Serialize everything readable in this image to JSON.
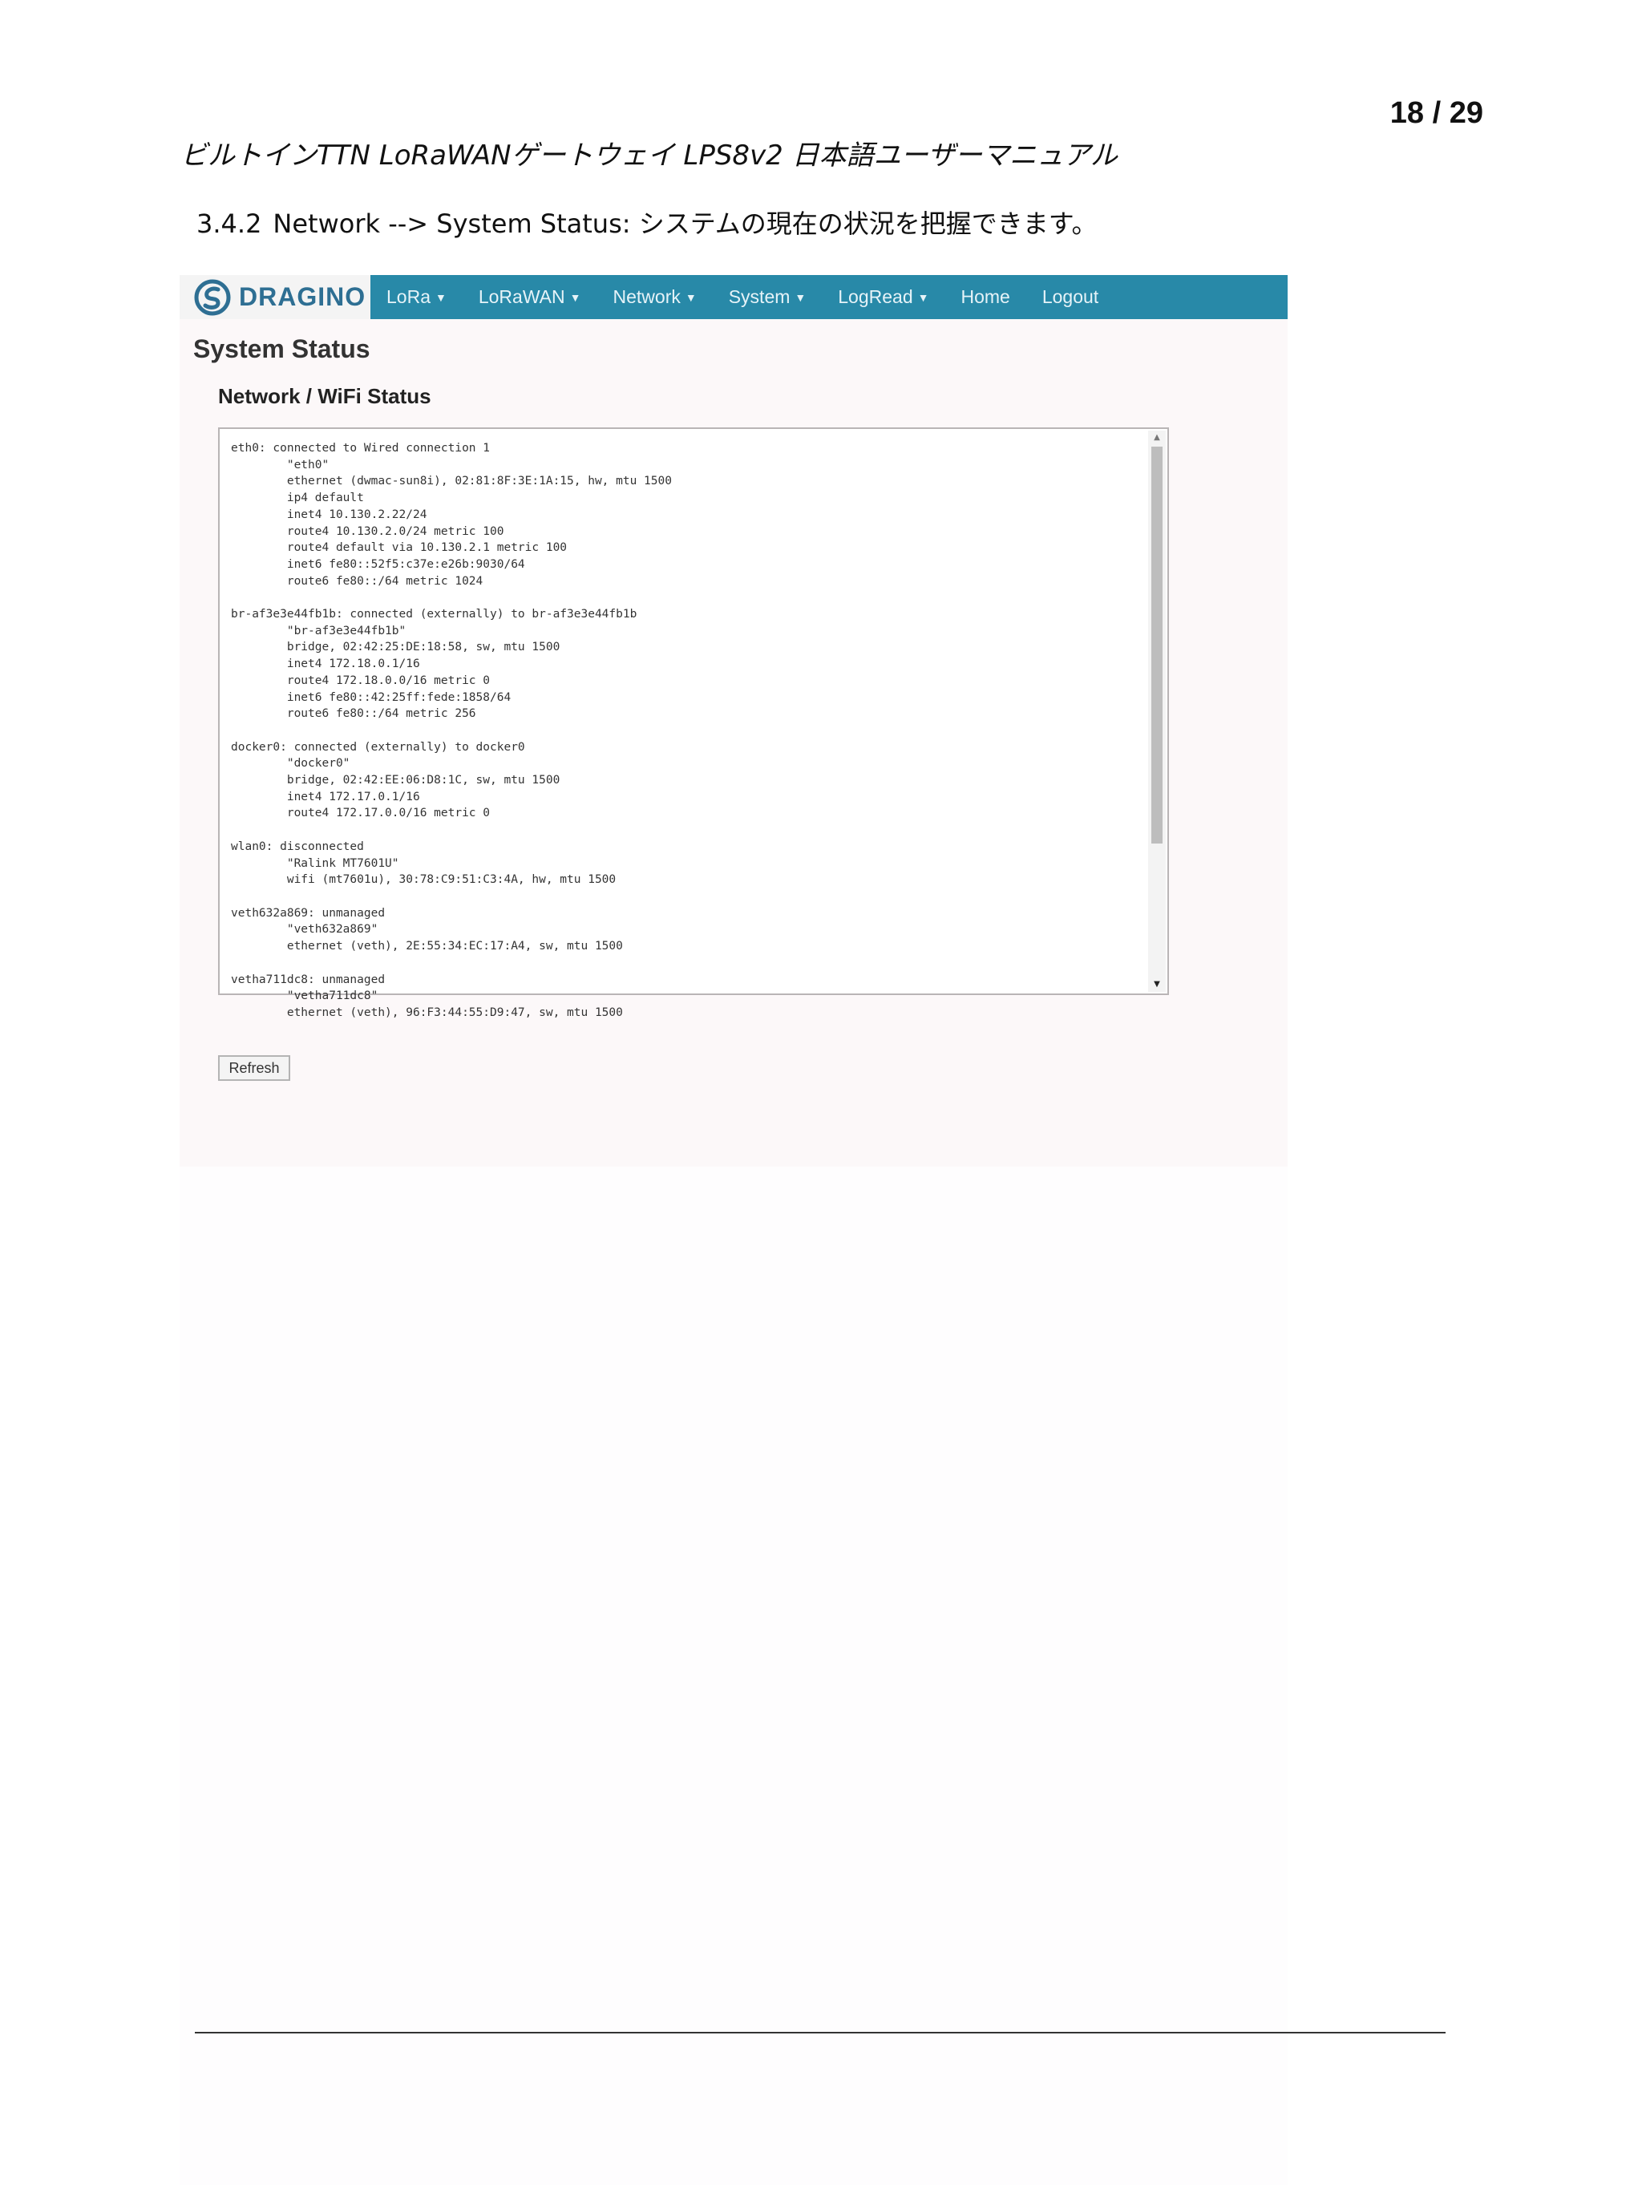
{
  "page": {
    "number": "18 / 29"
  },
  "document": {
    "title": "ビルトインTTN LoRaWANゲートウェイ LPS8v2 日本語ユーザーマニュアル",
    "section_number": "3.4.2",
    "section_heading": "Network --> System Status:  システムの現在の状況を把握できます。"
  },
  "screenshot": {
    "nav": {
      "brand": "DRAGINO",
      "items": [
        {
          "label": "LoRa",
          "caret": "▼"
        },
        {
          "label": "LoRaWAN",
          "caret": "▼"
        },
        {
          "label": "Network",
          "caret": "▼"
        },
        {
          "label": "System",
          "caret": "▼"
        },
        {
          "label": "LogRead",
          "caret": "▼"
        },
        {
          "label": "Home",
          "caret": ""
        },
        {
          "label": "Logout",
          "caret": ""
        }
      ]
    },
    "page_title": "System Status",
    "section_title": "Network / WiFi Status",
    "status_text": "eth0: connected to Wired connection 1\n        \"eth0\"\n        ethernet (dwmac-sun8i), 02:81:8F:3E:1A:15, hw, mtu 1500\n        ip4 default\n        inet4 10.130.2.22/24\n        route4 10.130.2.0/24 metric 100\n        route4 default via 10.130.2.1 metric 100\n        inet6 fe80::52f5:c37e:e26b:9030/64\n        route6 fe80::/64 metric 1024\n\nbr-af3e3e44fb1b: connected (externally) to br-af3e3e44fb1b\n        \"br-af3e3e44fb1b\"\n        bridge, 02:42:25:DE:18:58, sw, mtu 1500\n        inet4 172.18.0.1/16\n        route4 172.18.0.0/16 metric 0\n        inet6 fe80::42:25ff:fede:1858/64\n        route6 fe80::/64 metric 256\n\ndocker0: connected (externally) to docker0\n        \"docker0\"\n        bridge, 02:42:EE:06:D8:1C, sw, mtu 1500\n        inet4 172.17.0.1/16\n        route4 172.17.0.0/16 metric 0\n\nwlan0: disconnected\n        \"Ralink MT7601U\"\n        wifi (mt7601u), 30:78:C9:51:C3:4A, hw, mtu 1500\n\nveth632a869: unmanaged\n        \"veth632a869\"\n        ethernet (veth), 2E:55:34:EC:17:A4, sw, mtu 1500\n\nvetha711dc8: unmanaged\n        \"vetha711dc8\"\n        ethernet (veth), 96:F3:44:55:D9:47, sw, mtu 1500",
    "refresh_label": "Refresh",
    "colors": {
      "nav_bar": "#2889a8",
      "brand_text": "#2e6f93",
      "background": "#fcf8f9"
    }
  }
}
